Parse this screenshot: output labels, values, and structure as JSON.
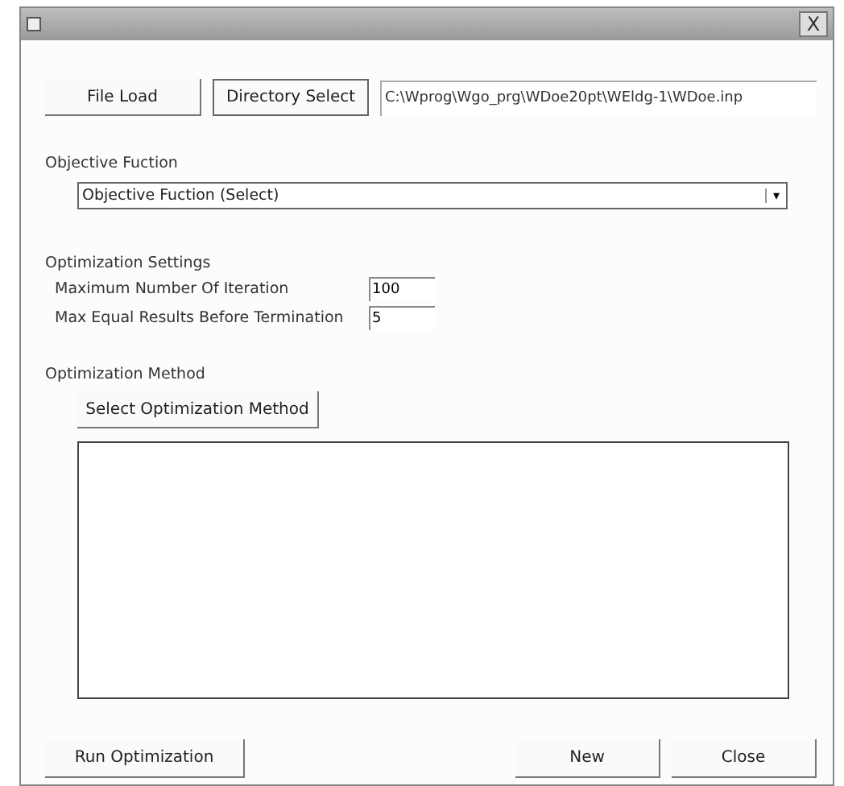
{
  "file_buttons": [
    "File Load",
    "Directory Select"
  ],
  "path": {
    "value": "C:\\Wprog\\Wgo_prg\\WDoe20pt\\WEldg-1\\WDoe.inp"
  },
  "objective": {
    "label": "Objective Fuction",
    "dropdown": {
      "value": "Objective Fuction (Select)",
      "arrow": "▾"
    }
  },
  "settings": {
    "label": "Optimization Settings",
    "fields": [
      {
        "label": "Maximum Number Of Iteration",
        "value": "100"
      },
      {
        "label": "Max Equal Results Before Termination",
        "value": "5"
      }
    ]
  },
  "method": {
    "label": "Optimization Method",
    "button": "Select Optimization Method"
  },
  "bottom_buttons": [
    "Run Optimization",
    "New",
    "Close"
  ],
  "close_glyph": "X"
}
